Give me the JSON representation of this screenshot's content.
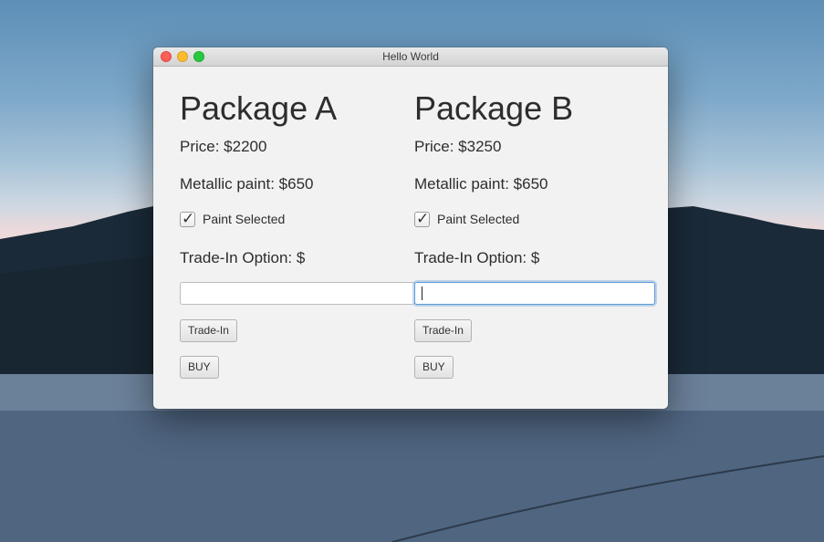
{
  "window": {
    "title": "Hello World"
  },
  "package_a": {
    "heading": "Package A",
    "price": "Price: $2200",
    "metallic_paint": "Metallic paint: $650",
    "paint_checkbox_label": "Paint Selected",
    "paint_checked": true,
    "trade_in_label": "Trade-In Option: $",
    "trade_in_value": "",
    "trade_in_button": "Trade-In",
    "buy_button": "BUY"
  },
  "package_b": {
    "heading": "Package B",
    "price": "Price: $3250",
    "metallic_paint": "Metallic paint: $650",
    "paint_checkbox_label": "Paint Selected",
    "paint_checked": true,
    "trade_in_label": "Trade-In Option: $",
    "trade_in_value": "",
    "trade_in_button": "Trade-In",
    "buy_button": "BUY"
  },
  "colors": {
    "close": "#fc5f57",
    "minimize": "#fdbc2e",
    "maximize": "#28c840",
    "focus_ring": "#5b9ad7"
  },
  "icons": {
    "checkmark": "✓"
  }
}
